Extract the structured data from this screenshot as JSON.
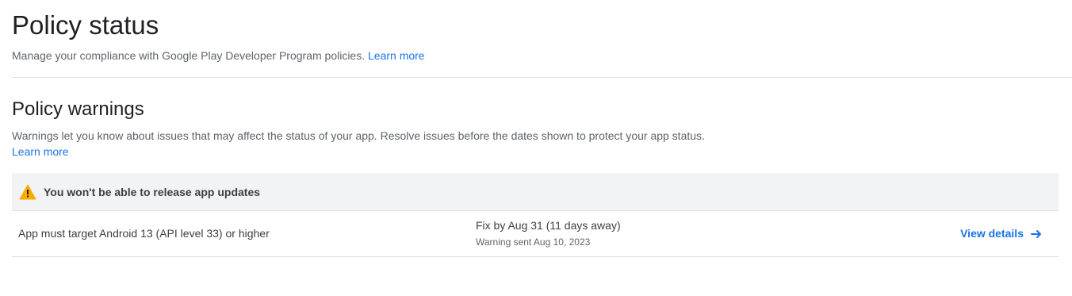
{
  "page": {
    "title": "Policy status",
    "subtitle": "Manage your compliance with Google Play Developer Program policies.",
    "learn_more": "Learn more"
  },
  "warnings_section": {
    "title": "Policy warnings",
    "description": "Warnings let you know about issues that may affect the status of your app. Resolve issues before the dates shown to protect your app status.",
    "learn_more": "Learn more",
    "group": {
      "icon": "warning-triangle-icon",
      "icon_color": "#f9ab00",
      "header": "You won't be able to release app updates",
      "rows": [
        {
          "policy": "App must target Android 13 (API level 33) or higher",
          "fix_by": "Fix by Aug 31 (11 days away)",
          "warning_sent": "Warning sent Aug 10, 2023",
          "action_label": "View details",
          "action_icon": "arrow-right-icon"
        }
      ]
    }
  },
  "colors": {
    "link": "#1a73e8",
    "header_background": "#f1f3f4",
    "divider": "#dadce0"
  }
}
